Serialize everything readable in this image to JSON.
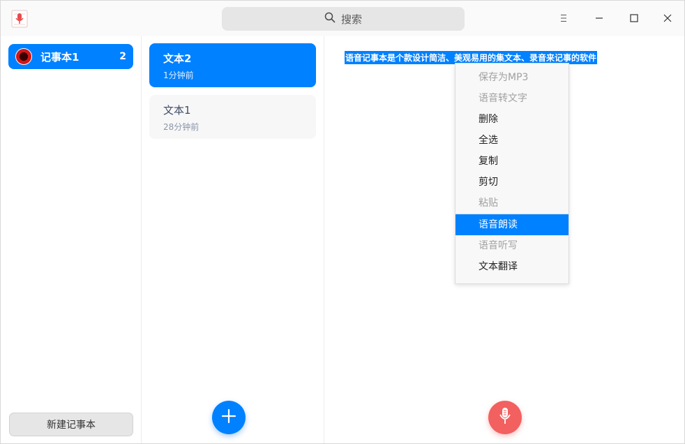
{
  "search": {
    "label": "搜索"
  },
  "sidebar": {
    "notebooks": [
      {
        "name": "记事本1",
        "count": "2"
      }
    ],
    "new_notebook_label": "新建记事本"
  },
  "notes": [
    {
      "title": "文本2",
      "time": "1分钟前",
      "active": true
    },
    {
      "title": "文本1",
      "time": "28分钟前",
      "active": false
    }
  ],
  "editor": {
    "selected_text": "语音记事本是个款设计简洁、美观易用的集文本、录音来记事的软件"
  },
  "context_menu": {
    "items": [
      {
        "label": "保存为MP3",
        "state": "disabled"
      },
      {
        "label": "语音转文字",
        "state": "disabled"
      },
      {
        "label": "删除",
        "state": "enabled"
      },
      {
        "label": "全选",
        "state": "enabled"
      },
      {
        "label": "复制",
        "state": "enabled"
      },
      {
        "label": "剪切",
        "state": "enabled"
      },
      {
        "label": "粘贴",
        "state": "disabled"
      },
      {
        "label": "语音朗读",
        "state": "highlighted"
      },
      {
        "label": "语音听写",
        "state": "disabled"
      },
      {
        "label": "文本翻译",
        "state": "enabled"
      }
    ]
  },
  "colors": {
    "accent": "#0081ff",
    "record": "#f26060",
    "disabled_text": "#a0a0a0"
  },
  "icons": [
    "app-microphone-icon",
    "search-icon",
    "menu-icon",
    "minimize-icon",
    "maximize-icon",
    "close-icon",
    "plus-icon",
    "microphone-icon"
  ]
}
